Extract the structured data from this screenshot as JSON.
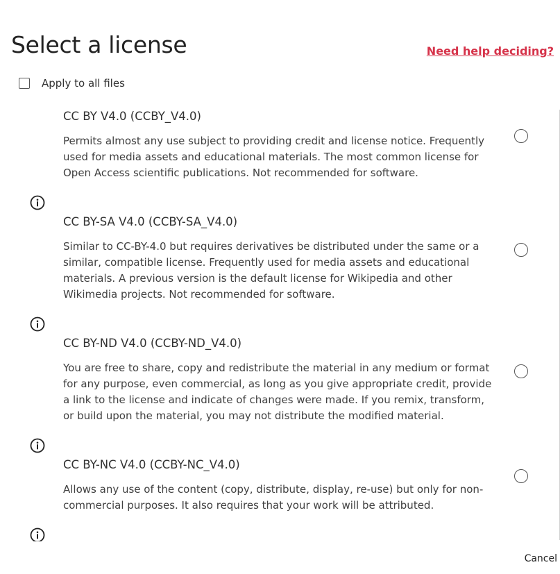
{
  "dialog": {
    "title": "Select a license",
    "help_link": "Need help deciding?",
    "apply_all_label": "Apply to all files",
    "apply_all_checked": false,
    "cancel_label": "Cancel"
  },
  "licenses": [
    {
      "title": "CC BY V4.0 (CCBY_V4.0)",
      "description": "Permits almost any use subject to providing credit and license notice. Frequently used for media assets and educational materials. The most common license for Open Access scientific publications. Not recommended for software.",
      "selected": false
    },
    {
      "title": "CC BY-SA V4.0 (CCBY-SA_V4.0)",
      "description": "Similar to CC-BY-4.0 but requires derivatives be distributed under the same or a similar, compatible license. Frequently used for media assets and educational materials. A previous version is the default license for Wikipedia and other Wikimedia projects. Not recommended for software.",
      "selected": false
    },
    {
      "title": "CC BY-ND V4.0 (CCBY-ND_V4.0)",
      "description": "You are free to share, copy and redistribute the material in any medium or format for any purpose, even commercial, as long as you give appropriate credit, provide a link to the license and indicate of changes were made. If you remix, transform, or build upon the material, you may not distribute the modified material.",
      "selected": false
    },
    {
      "title": "CC BY-NC V4.0 (CCBY-NC_V4.0)",
      "description": "Allows any use of the content (copy, distribute, display, re-use) but only for non-commercial purposes. It also requires that your work will be attributed.",
      "selected": false
    }
  ],
  "icons": {
    "info": "info-circle-icon",
    "radio": "radio-button-icon",
    "checkbox": "checkbox-icon"
  },
  "colors": {
    "link": "#d6334a",
    "text": "#323232",
    "border": "#555555"
  }
}
